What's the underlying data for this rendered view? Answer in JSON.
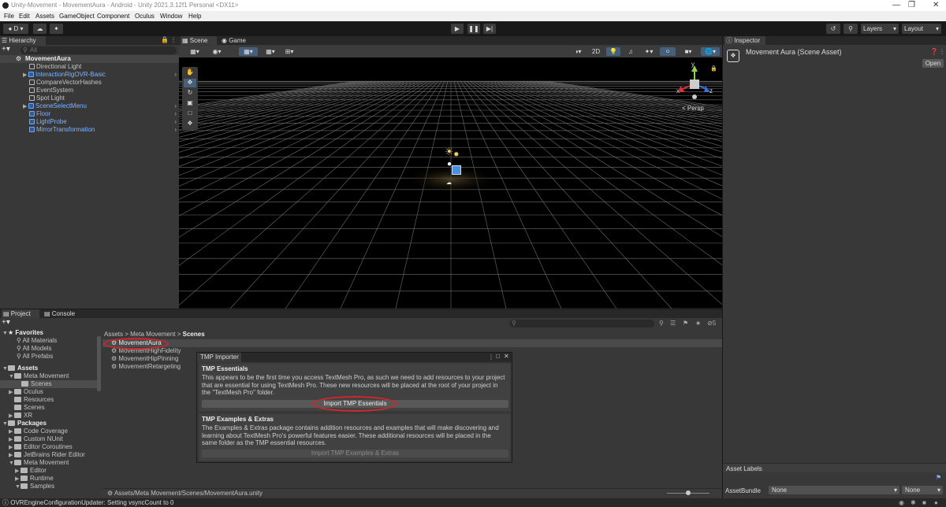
{
  "window": {
    "title": "Unity-Movement - MovementAura - Android - Unity 2021.3.12f1 Personal <DX11>"
  },
  "menu": [
    "File",
    "Edit",
    "Assets",
    "GameObject",
    "Component",
    "Oculus",
    "Window",
    "Help"
  ],
  "toolbar": {
    "account_label": "D",
    "layers_label": "Layers",
    "layout_label": "Layout"
  },
  "hierarchy": {
    "tab": "Hierarchy",
    "search_placeholder": "All",
    "scene": "MovementAura",
    "items": [
      {
        "label": "Directional Light",
        "prefab": false
      },
      {
        "label": "InteractionRigOVR-Basic",
        "prefab": true
      },
      {
        "label": "CompareVectorHashes",
        "prefab": false
      },
      {
        "label": "EventSystem",
        "prefab": false
      },
      {
        "label": "Spot Light",
        "prefab": false
      },
      {
        "label": "SceneSelectMenu",
        "prefab": true
      },
      {
        "label": "Floor",
        "prefab": true
      },
      {
        "label": "LightProbe",
        "prefab": true
      },
      {
        "label": "MirrorTransformation",
        "prefab": true
      }
    ]
  },
  "scene_view": {
    "tabs": [
      "Scene",
      "Game"
    ],
    "mode_2d": "2D",
    "persp_label": "Persp",
    "gizmo_axes": {
      "y": "y",
      "x": "x",
      "z": "z"
    }
  },
  "inspector": {
    "tab": "Inspector",
    "asset_title": "Movement Aura (Scene Asset)",
    "open_button": "Open",
    "asset_labels": "Asset Labels",
    "assetbundle_label": "AssetBundle",
    "assetbundle_value": "None",
    "variant_value": "None"
  },
  "project": {
    "tabs": [
      "Project",
      "Console"
    ],
    "hidden_count": "5",
    "breadcrumb": [
      "Assets",
      "Meta Movement",
      "Scenes"
    ],
    "favorites_label": "Favorites",
    "favorites": [
      "All Materials",
      "All Models",
      "All Prefabs"
    ],
    "assets_label": "Assets",
    "assets_tree": [
      {
        "label": "Meta Movement",
        "depth": 1,
        "expanded": true
      },
      {
        "label": "Scenes",
        "depth": 2,
        "selected": true
      },
      {
        "label": "Oculus",
        "depth": 1
      },
      {
        "label": "Resources",
        "depth": 1
      },
      {
        "label": "Scenes",
        "depth": 1
      },
      {
        "label": "XR",
        "depth": 1
      }
    ],
    "packages_label": "Packages",
    "packages_tree": [
      {
        "label": "Code Coverage",
        "depth": 1
      },
      {
        "label": "Custom NUnit",
        "depth": 1
      },
      {
        "label": "Editor Coroutines",
        "depth": 1
      },
      {
        "label": "JetBrains Rider Editor",
        "depth": 1
      },
      {
        "label": "Meta Movement",
        "depth": 1,
        "expanded": true
      },
      {
        "label": "Editor",
        "depth": 2
      },
      {
        "label": "Runtime",
        "depth": 2
      },
      {
        "label": "Samples",
        "depth": 2,
        "expanded": true
      }
    ],
    "files": [
      "MovementAura",
      "MovementHighFidelity",
      "MovementHipPinning",
      "MovementRetargeting"
    ],
    "footer_path": "Assets/Meta Movement/Scenes/MovementAura.unity"
  },
  "tmp_dialog": {
    "title": "TMP Importer",
    "essentials_heading": "TMP Essentials",
    "essentials_text": "This appears to be the first time you access TextMesh Pro, as such we need to add resources to your project that are essential for using TextMesh Pro. These new resources will be placed at the root of your project in the \"TextMesh Pro\" folder.",
    "essentials_button": "Import TMP Essentials",
    "extras_heading": "TMP Examples & Extras",
    "extras_text": "The Examples & Extras package contains addition resources and examples that will make discovering and learning about TextMesh Pro's powerful features easier. These additional resources will be placed in the same folder as the TMP essential resources.",
    "extras_button": "Import TMP Examples & Extras"
  },
  "status_bar": {
    "message": "OVREngineConfigurationUpdater: Setting vsyncCount to 0"
  },
  "colors": {
    "highlight_oval": "#d1262e",
    "prefab_blue": "#7fb4ff",
    "selection": "#2c5d87"
  }
}
